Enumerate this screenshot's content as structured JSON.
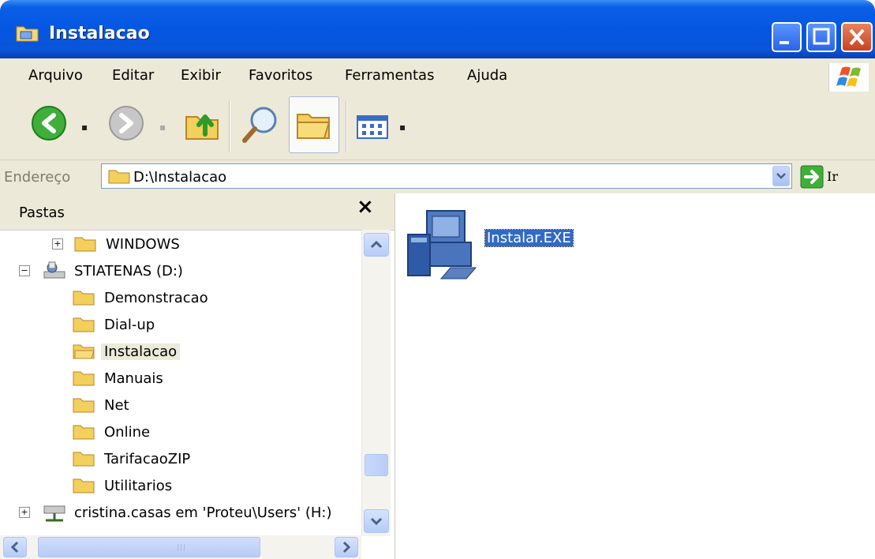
{
  "window": {
    "title": "Instalacao"
  },
  "menu": [
    "Arquivo",
    "Editar",
    "Exibir",
    "Favoritos",
    "Ferramentas",
    "Ajuda"
  ],
  "toolbar": {
    "icons": [
      "back-arrow-icon",
      "forward-arrow-icon",
      "up-folder-icon",
      "search-icon",
      "folders-icon",
      "views-icon"
    ]
  },
  "address": {
    "label": "Endereço",
    "value": "D:\\Instalacao",
    "go_label": "Ir"
  },
  "folders_pane": {
    "title": "Pastas",
    "close_label": "×",
    "tree": [
      {
        "label": "WINDOWS",
        "expander": "+"
      },
      {
        "label": "STIATENAS (D:)",
        "expander": "−"
      },
      {
        "label": "Demonstracao"
      },
      {
        "label": "Dial-up"
      },
      {
        "label": "Instalacao",
        "selected": true
      },
      {
        "label": "Manuais"
      },
      {
        "label": "Net"
      },
      {
        "label": "Online"
      },
      {
        "label": "TarifacaoZIP"
      },
      {
        "label": "Utilitarios"
      },
      {
        "label": "cristina.casas em 'Proteu\\Users' (H:)",
        "expander": "+"
      }
    ]
  },
  "content": {
    "files": [
      {
        "name": "Instalar.EXE",
        "icon": "installer-exe-icon",
        "selected": true
      }
    ]
  },
  "colors": {
    "title_bar": "#0456e2",
    "selection": "#316ac5",
    "chrome": "#ece9d8"
  }
}
